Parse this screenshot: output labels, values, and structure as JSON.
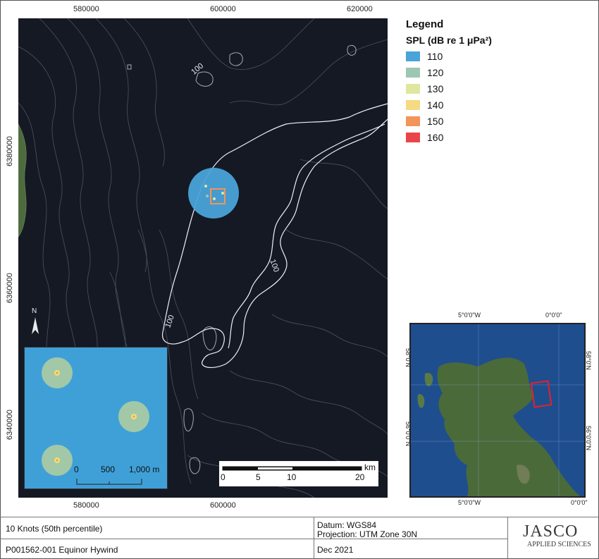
{
  "map": {
    "x_ticks": [
      "580000",
      "600000",
      "620000"
    ],
    "y_ticks": [
      "6380000",
      "6360000",
      "6340000"
    ],
    "contour_labels": [
      "100",
      "100",
      "100"
    ]
  },
  "legend": {
    "title": "Legend",
    "subtitle": "SPL (dB re 1 μPa²)",
    "items": [
      {
        "label": "110",
        "color": "#4aa3d9"
      },
      {
        "label": "120",
        "color": "#9dc7b2"
      },
      {
        "label": "130",
        "color": "#dfe6a0"
      },
      {
        "label": "140",
        "color": "#f5da82"
      },
      {
        "label": "150",
        "color": "#f3945a"
      },
      {
        "label": "160",
        "color": "#e8454a"
      }
    ]
  },
  "inset": {
    "scale_labels": [
      "0",
      "500",
      "1,000 m"
    ]
  },
  "scalebar": {
    "unit": "km",
    "labels": [
      "0",
      "5",
      "10",
      "20"
    ]
  },
  "north_arrow": "N",
  "overview": {
    "top_labels": [
      "5°0'0\"W",
      "0°0'0\""
    ],
    "bottom_labels": [
      "5°0'0\"W",
      "0°0'0\""
    ],
    "left_labels": [
      "58°0'N",
      "56°0'0\"N"
    ],
    "right_labels": [
      "58°0'N",
      "56°0'0\"N"
    ],
    "extent_color": "#e8202a"
  },
  "footer": {
    "scenario": "10 Knots (50th percentile)",
    "project": "P001562-001 Equinor Hywind",
    "datum": "Datum: WGS84",
    "projection": "Projection: UTM Zone 30N",
    "date": "Dec 2021",
    "logo_main": "JASCO",
    "logo_sub": "APPLIED SCIENCES"
  }
}
